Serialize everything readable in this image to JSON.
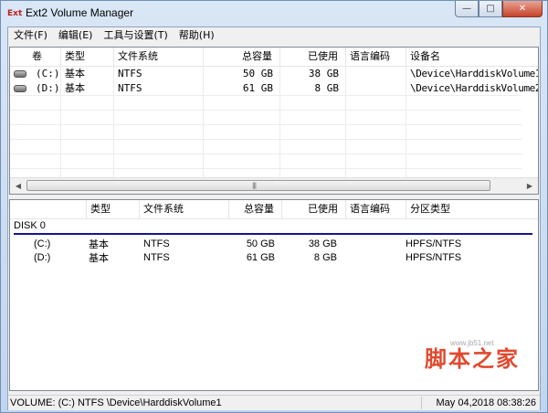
{
  "window": {
    "title": "Ext2 Volume Manager",
    "app_icon_text": "Ext",
    "min_glyph": "—",
    "max_glyph": "□",
    "close_glyph": "✕"
  },
  "menu": [
    "文件(F)",
    "编辑(E)",
    "工具与设置(T)",
    "帮助(H)"
  ],
  "volume_table": {
    "headers": [
      "卷",
      "类型",
      "文件系统",
      "总容量",
      "已使用",
      "语言编码",
      "设备名"
    ],
    "rows": [
      {
        "volume": "(C:)",
        "type": "基本",
        "fs": "NTFS",
        "total": "50 GB",
        "used": "38 GB",
        "codepage": "",
        "device": "\\Device\\HarddiskVolume1"
      },
      {
        "volume": "(D:)",
        "type": "基本",
        "fs": "NTFS",
        "total": "61 GB",
        "used": "8 GB",
        "codepage": "",
        "device": "\\Device\\HarddiskVolume2"
      }
    ]
  },
  "scrollbar": {
    "left": "◀",
    "right": "▶",
    "grip": "|||"
  },
  "disk_table": {
    "headers": [
      "",
      "类型",
      "文件系统",
      "总容量",
      "已使用",
      "语言编码",
      "分区类型"
    ],
    "disk_label": "DISK 0",
    "partitions": [
      {
        "volume": "(C:)",
        "type": "基本",
        "fs": "NTFS",
        "total": "50 GB",
        "used": "38 GB",
        "codepage": "",
        "ptype": "HPFS/NTFS"
      },
      {
        "volume": "(D:)",
        "type": "基本",
        "fs": "NTFS",
        "total": "61 GB",
        "used": "8 GB",
        "codepage": "",
        "ptype": "HPFS/NTFS"
      }
    ]
  },
  "status": {
    "left": "VOLUME: (C:) NTFS \\Device\\HarddiskVolume1",
    "right": "May 04,2018 08:38:26"
  },
  "watermark": {
    "main": "脚本之家",
    "sub": "www.jb51.net"
  }
}
